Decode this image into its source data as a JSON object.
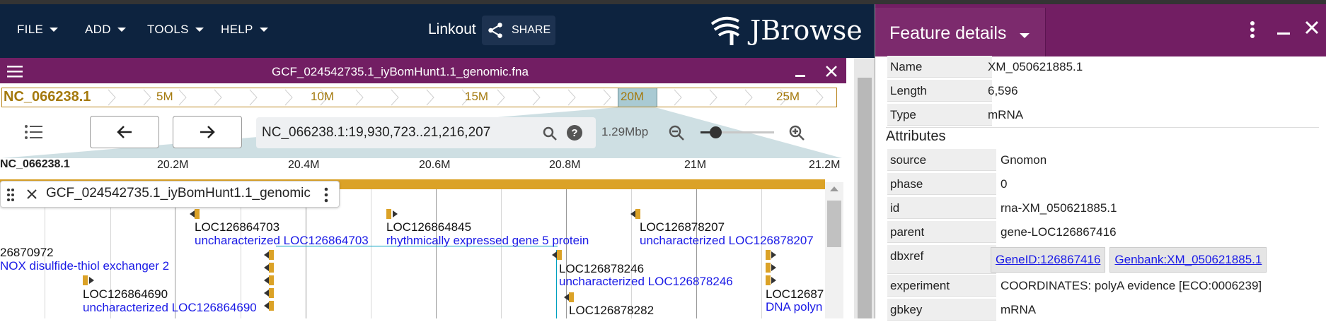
{
  "menu": {
    "file": "FILE",
    "add": "ADD",
    "tools": "TOOLS",
    "help": "HELP"
  },
  "header": {
    "linkout": "Linkout",
    "share": "SHARE",
    "logo": "JBrowse"
  },
  "view": {
    "title": "GCF_024542735.1_iyBomHunt1.1_genomic.fna",
    "refname": "NC_066238.1",
    "overview_ticks": [
      "5M",
      "10M",
      "15M",
      "20M",
      "25M"
    ],
    "location": "NC_066238.1:19,930,723..21,216,207",
    "bp": "1.29Mbp",
    "scale_ref": "NC_066238.1",
    "scale_ticks": [
      "20.2M",
      "20.4M",
      "20.6M",
      "20.8M",
      "21M",
      "21.2M"
    ],
    "track_name": "GCF_024542735.1_iyBomHunt1.1_genomic"
  },
  "features": [
    {
      "name": "LOC126864703",
      "desc": "uncharacterized LOC126864703"
    },
    {
      "name": "LOC126864845",
      "desc": "rhythmically expressed gene 5 protein"
    },
    {
      "name": "LOC126878207",
      "desc": "uncharacterized LOC126878207"
    },
    {
      "name": "26870972",
      "desc": "NOX disulfide-thiol exchanger 2"
    },
    {
      "name": "LOC126878246",
      "desc": "uncharacterized LOC126878246"
    },
    {
      "name": "LOC126864690",
      "desc": "uncharacterized LOC126864690"
    },
    {
      "name": "LOC126878282",
      "desc": ""
    },
    {
      "name": "LOC12687",
      "desc": "DNA polyn"
    }
  ],
  "details": {
    "title": "Feature details",
    "top": [
      {
        "key": "Name",
        "value": "XM_050621885.1"
      },
      {
        "key": "Length",
        "value": "6,596"
      },
      {
        "key": "Type",
        "value": "mRNA"
      }
    ],
    "attributes_heading": "Attributes",
    "attributes": [
      {
        "key": "source",
        "value": "Gnomon"
      },
      {
        "key": "phase",
        "value": "0"
      },
      {
        "key": "id",
        "value": "rna-XM_050621885.1"
      },
      {
        "key": "parent",
        "value": "gene-LOC126867416"
      },
      {
        "key": "dbxref",
        "links": [
          "GeneID:126867416",
          "Genbank:XM_050621885.1"
        ]
      },
      {
        "key": "experiment",
        "value": "COORDINATES: polyA evidence [ECO:0006239]"
      },
      {
        "key": "gbkey",
        "value": "mRNA"
      }
    ]
  },
  "colors": {
    "appbar": "#0d233f",
    "accent": "#721e63",
    "gold": "#dba227",
    "link": "#1a1ae6"
  }
}
